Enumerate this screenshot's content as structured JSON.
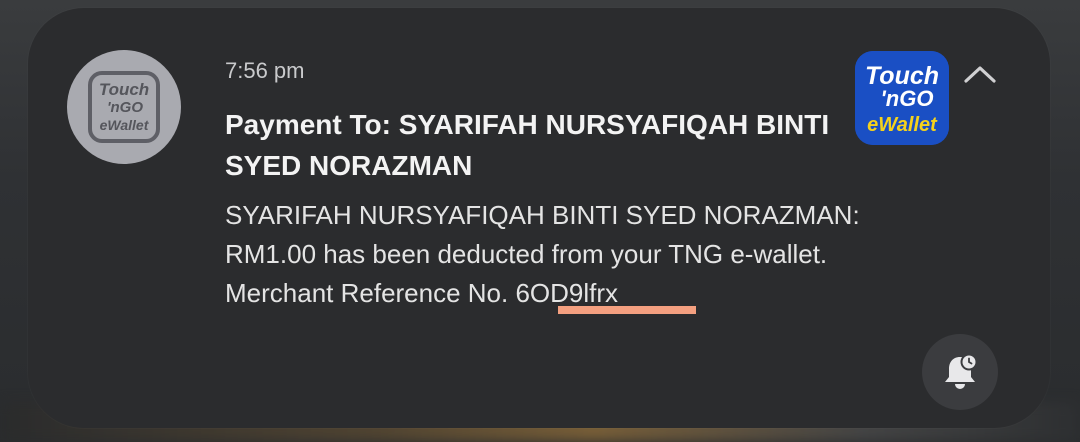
{
  "notification": {
    "app_logo_text": {
      "line1": "Touch",
      "line2": "'nGO",
      "line3": "eWallet"
    },
    "time": "7:56 pm",
    "title": "Payment To: SYARIFAH NURSYAFIQAH BINTI SYED NORAZMAN",
    "body_line1": "SYARIFAH NURSYAFIQAH BINTI SYED NORAZMAN:",
    "body_line2": "RM1.00 has been deducted from your TNG e-wallet.",
    "body_line3_prefix": "Merchant Reference No. ",
    "merchant_reference": "6OD9lfrx",
    "highlight_color": "#f4a080",
    "brand_colors": {
      "blue": "#1a4fc4",
      "yellow": "#f5d21c"
    },
    "icons": {
      "collapse": "chevron-up-icon",
      "snooze": "bell-snooze-icon"
    }
  }
}
